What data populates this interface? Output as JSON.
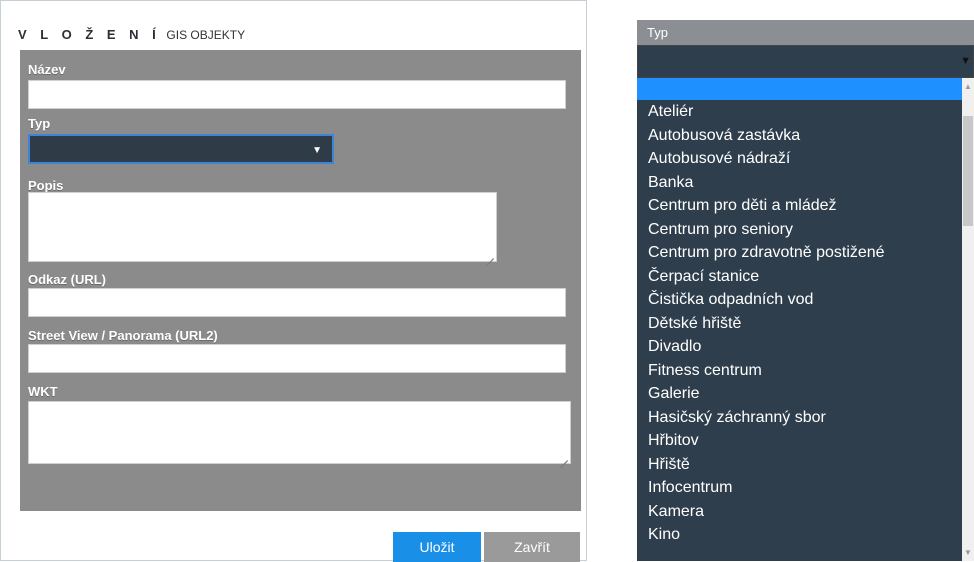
{
  "dialog": {
    "title_strong": "V L O Ž E N Í",
    "title_sub": "GIS OBJEKTY",
    "fields": {
      "nazev_label": "Název",
      "typ_label": "Typ",
      "popis_label": "Popis",
      "odkaz_label": "Odkaz (URL)",
      "streetview_label": "Street View / Panorama (URL2)",
      "wkt_label": "WKT"
    },
    "buttons": {
      "save": "Uložit",
      "close": "Zavřít"
    }
  },
  "dropdown": {
    "header": "Typ",
    "items": [
      "Ateliér",
      "Autobusová zastávka",
      "Autobusové nádraží",
      "Banka",
      "Centrum pro děti a mládež",
      "Centrum pro seniory",
      "Centrum pro zdravotně postižené",
      "Čerpací stanice",
      "Čistička odpadních vod",
      "Dětské hřiště",
      "Divadlo",
      "Fitness centrum",
      "Galerie",
      "Hasičský záchranný sbor",
      "Hřbitov",
      "Hřiště",
      "Infocentrum",
      "Kamera",
      "Kino"
    ]
  },
  "colors": {
    "accent": "#1a8fe8",
    "panel": "#8b8b8b",
    "dark": "#2f3e4c"
  }
}
